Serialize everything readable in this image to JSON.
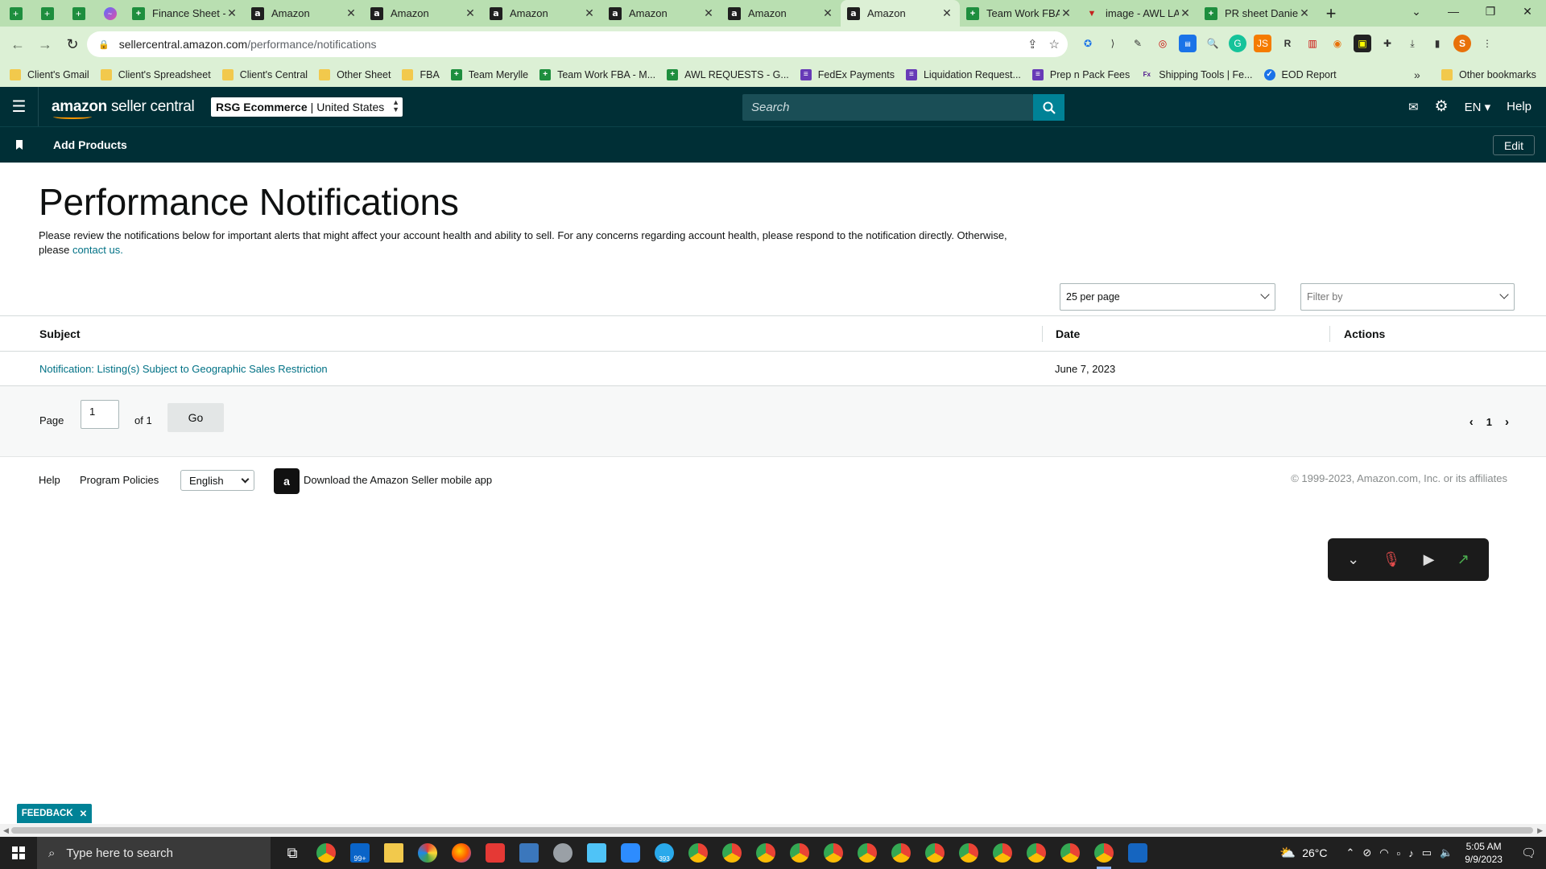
{
  "browser": {
    "tabs": [
      {
        "title": "Finance Sheet -",
        "icon": "sheets-icon",
        "active": false
      },
      {
        "title": "Amazon",
        "icon": "amazon-icon",
        "active": false
      },
      {
        "title": "Amazon",
        "icon": "amazon-icon",
        "active": false
      },
      {
        "title": "Amazon",
        "icon": "amazon-icon",
        "active": false
      },
      {
        "title": "Amazon",
        "icon": "amazon-icon",
        "active": false
      },
      {
        "title": "Amazon",
        "icon": "amazon-icon",
        "active": false
      },
      {
        "title": "Amazon",
        "icon": "amazon-icon",
        "active": true
      },
      {
        "title": "Team Work FBA",
        "icon": "sheets-icon",
        "active": false
      },
      {
        "title": "image - AWL LA",
        "icon": "forms-icon",
        "active": false
      },
      {
        "title": "PR sheet Daniel",
        "icon": "sheets-icon",
        "active": false
      }
    ],
    "url_host": "sellercentral.amazon.com",
    "url_path": "/performance/notifications",
    "profile_initial": "S",
    "bookmarks": [
      {
        "label": "Client's Gmail",
        "icon": "folder"
      },
      {
        "label": "Client's Spreadsheet",
        "icon": "folder"
      },
      {
        "label": "Client's Central",
        "icon": "folder"
      },
      {
        "label": "Other Sheet",
        "icon": "folder"
      },
      {
        "label": "FBA",
        "icon": "folder"
      },
      {
        "label": "Team Merylle",
        "icon": "sheet"
      },
      {
        "label": "Team Work FBA - M...",
        "icon": "sheet"
      },
      {
        "label": "AWL REQUESTS - G...",
        "icon": "sheet"
      },
      {
        "label": "FedEx Payments",
        "icon": "purple"
      },
      {
        "label": "Liquidation Request...",
        "icon": "purple"
      },
      {
        "label": "Prep n Pack Fees",
        "icon": "purple"
      },
      {
        "label": "Shipping Tools | Fe...",
        "icon": "fedex"
      },
      {
        "label": "EOD Report",
        "icon": "eod"
      }
    ],
    "bookmarks_overflow": "»",
    "other_bookmarks": "Other bookmarks"
  },
  "header": {
    "logo_main": "amazon",
    "logo_sub": "seller central",
    "account_name": "RSG Ecommerce",
    "account_region": "United States",
    "search_placeholder": "Search",
    "language": "EN",
    "help": "Help"
  },
  "subnav": {
    "link": "Add Products",
    "edit": "Edit"
  },
  "page": {
    "title": "Performance Notifications",
    "description": "Please review the notifications below for important alerts that might affect your account health and ability to sell. For any concerns regarding account health, please respond to the notification directly. Otherwise, please",
    "contact_link": "contact us.",
    "per_page": "25 per page",
    "filter_placeholder": "Filter by"
  },
  "table": {
    "columns": [
      "Subject",
      "Date",
      "Actions"
    ],
    "rows": [
      {
        "subject": "Notification: Listing(s) Subject to Geographic Sales Restriction",
        "date": "June 7, 2023",
        "actions": ""
      }
    ]
  },
  "pagination": {
    "page_label": "Page",
    "current_page": "1",
    "of_label": "of 1",
    "go": "Go",
    "page_number": "1"
  },
  "footer": {
    "help": "Help",
    "program_policies": "Program Policies",
    "language": "English",
    "app_text": "Download the Amazon Seller mobile app",
    "copyright": "© 1999-2023, Amazon.com, Inc. or its affiliates"
  },
  "feedback": {
    "label": "FEEDBACK"
  },
  "taskbar": {
    "search_placeholder": "Type here to search",
    "mail_badge": "99+",
    "telegram_badge": "393",
    "temperature": "26°C",
    "time": "5:05 AM",
    "date": "9/9/2023"
  },
  "colors": {
    "sc_header": "#002f36",
    "accent_teal": "#008296",
    "link": "#007185",
    "browser_frame": "#b9dfb1"
  }
}
